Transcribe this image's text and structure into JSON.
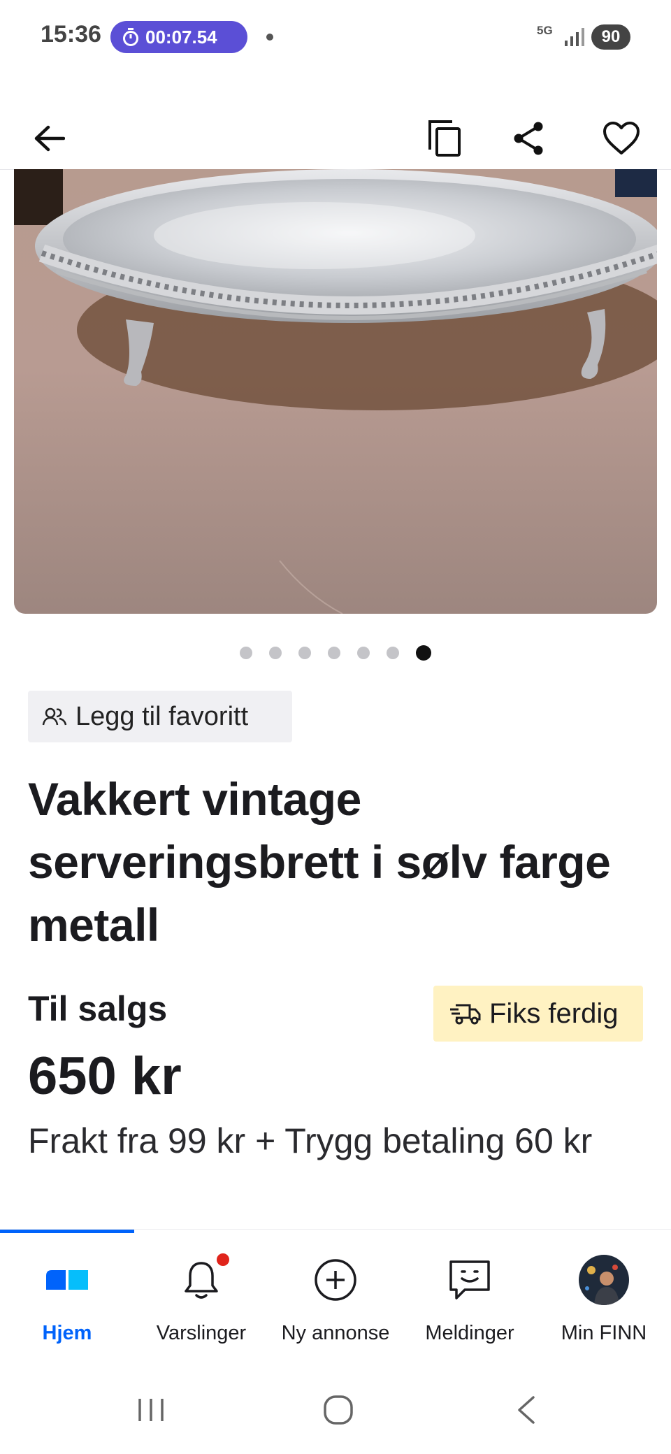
{
  "status_bar": {
    "time": "15:36",
    "timer": "00:07.54",
    "network": "5G",
    "battery": "90"
  },
  "top_bar": {
    "back_icon": "arrow-left-icon",
    "copy_icon": "copy-icon",
    "share_icon": "share-icon",
    "favorite_icon": "heart-icon"
  },
  "gallery": {
    "image_subject": "silver-tray-photo",
    "total_images": 7,
    "current_index": 7
  },
  "listing": {
    "fav_chip_label": "Legg til favoritt",
    "title": "Vakkert vintage serveringsbrett i sølv farge metall",
    "status": "Til salgs",
    "delivery_badge": "Fiks ferdig",
    "price": "650 kr",
    "shipping": "Frakt fra 99 kr + Trygg betaling 60 kr"
  },
  "bottom_nav": {
    "items": [
      {
        "label": "Hjem",
        "icon": "home-icon",
        "active": true
      },
      {
        "label": "Varslinger",
        "icon": "bell-icon",
        "badge": true
      },
      {
        "label": "Ny annonse",
        "icon": "plus-circle-icon"
      },
      {
        "label": "Meldinger",
        "icon": "chat-icon"
      },
      {
        "label": "Min FINN",
        "icon": "avatar"
      }
    ]
  },
  "colors": {
    "accent": "#0063fb",
    "timer_pill": "#5b4fd6",
    "fiks_badge_bg": "#fff2c2",
    "notification": "#e0241b"
  }
}
